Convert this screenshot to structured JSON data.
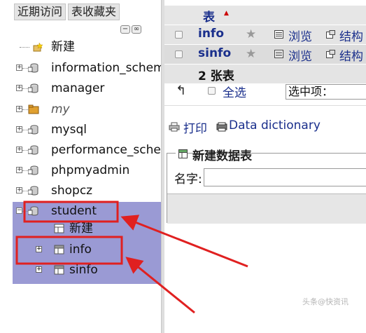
{
  "nav": {
    "tabs": [
      "近期访问",
      "表收藏夹"
    ],
    "collapse_symbol": "−",
    "link_symbol": "∞",
    "databases": [
      {
        "label": "新建",
        "italic": false
      },
      {
        "label": "information_schema",
        "italic": false
      },
      {
        "label": "manager",
        "italic": false
      },
      {
        "label": "my",
        "italic": true
      },
      {
        "label": "mysql",
        "italic": false
      },
      {
        "label": "performance_schema",
        "italic": false
      },
      {
        "label": "phpmyadmin",
        "italic": false
      },
      {
        "label": "shopcz",
        "italic": false
      },
      {
        "label": "student",
        "italic": false
      }
    ],
    "student_children": [
      {
        "label": "新建"
      },
      {
        "label": "info"
      },
      {
        "label": "sinfo"
      }
    ]
  },
  "main": {
    "table_header": "表",
    "rows": [
      {
        "name": "info",
        "browse": "浏览",
        "structure": "结构"
      },
      {
        "name": "sinfo",
        "browse": "浏览",
        "structure": "结构"
      }
    ],
    "summary": "2 张表",
    "check_all": "全选",
    "with_selected": "选中项：",
    "print": "打印",
    "data_dictionary": "Data dictionary",
    "create_table": {
      "legend": "新建数据表",
      "name_label": "名字:"
    }
  },
  "colors": {
    "highlight": "#9a9ad4",
    "link": "#1a2f8c",
    "annotation": "#e02020"
  },
  "watermark": "头条@快资讯"
}
